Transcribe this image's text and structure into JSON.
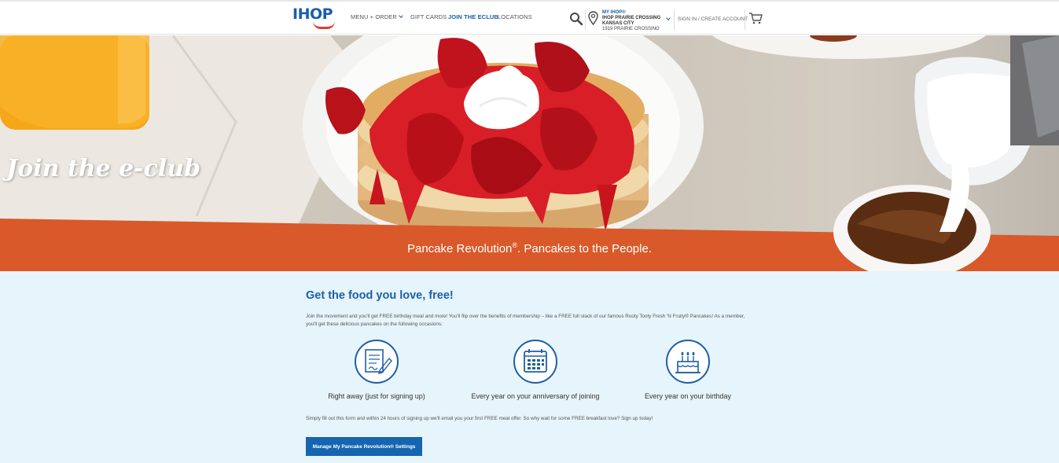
{
  "header": {
    "logo_text": "IHOP",
    "nav": [
      {
        "label": "MENU + ORDER"
      },
      {
        "label": "GIFT CARDS"
      },
      {
        "label": "JOIN THE eCLUB"
      },
      {
        "label": "LOCATIONS"
      }
    ],
    "store": {
      "my_label": "MY IHOP®",
      "name": "IHOP PRAIRIE CROSSING",
      "city": "KANSAS CITY",
      "address": "1919 PRAIRIE CROSSING"
    },
    "signin_label": "SIGN IN / CREATE ACCOUNT",
    "icons": [
      "search-icon",
      "location-pin-icon",
      "chevron-down-icon",
      "cart-icon"
    ]
  },
  "hero": {
    "title": "Join the e-club",
    "banner_text": "Pancake Revolution",
    "banner_reg": "®",
    "banner_tail": ". Pancakes to the People."
  },
  "main": {
    "heading": "Get the food you love, free!",
    "intro": "Join the movement and you'll get FREE birthday meal and more! You'll flip over the benefits of membership – like a FREE full stack of our famous Rooty Tooty Fresh 'N Fruity® Pancakes! As a member, you'll get these delicious pancakes on the following occasions:",
    "occasions": [
      {
        "label": "Right away (just for signing up)",
        "icon": "signup-form-icon"
      },
      {
        "label": "Every year on your anniversary of joining",
        "icon": "calendar-icon"
      },
      {
        "label": "Every year on your birthday",
        "icon": "birthday-cake-icon"
      }
    ],
    "outro": "Simply fill out this form and within 24 hours of signing up we'll email you your first FREE meal offer. So why wait for some FREE breakfast love? Sign up today!",
    "button_label": "Manage My Pancake Revolution® Settings"
  },
  "colors": {
    "brand_blue": "#1c5fa8",
    "banner_orange": "#d9592a",
    "content_bg": "#e6f4fb"
  }
}
